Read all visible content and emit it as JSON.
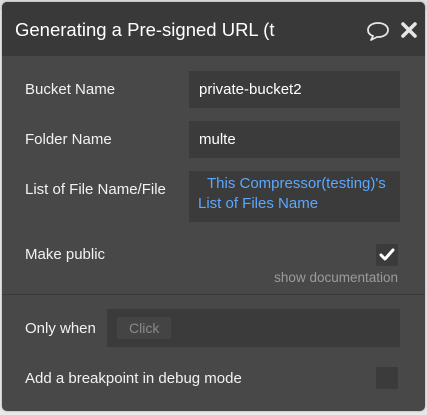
{
  "dialog": {
    "title": "Generating a Pre-signed URL (te",
    "icons": {
      "comment": "speech-bubble-icon",
      "close": "close-icon"
    }
  },
  "fields": {
    "bucket_name": {
      "label": "Bucket Name",
      "value": "private-bucket2"
    },
    "folder_name": {
      "label": "Folder Name",
      "value": "multe"
    },
    "file_list": {
      "label": "List of File Name/File",
      "value_line1": "This Compressor(testing)'s",
      "value_line2": "List of Files Name"
    },
    "make_public": {
      "label": "Make public",
      "checked": true
    }
  },
  "show_documentation": "show documentation",
  "conditions": {
    "only_when": {
      "label": "Only when",
      "placeholder": "Click"
    },
    "breakpoint": {
      "label": "Add a breakpoint in debug mode",
      "checked": false
    }
  },
  "colors": {
    "panel": "#484848",
    "titlebar": "#393939",
    "field": "#3b3b3b",
    "dynamic_text": "#5aa8ff"
  }
}
